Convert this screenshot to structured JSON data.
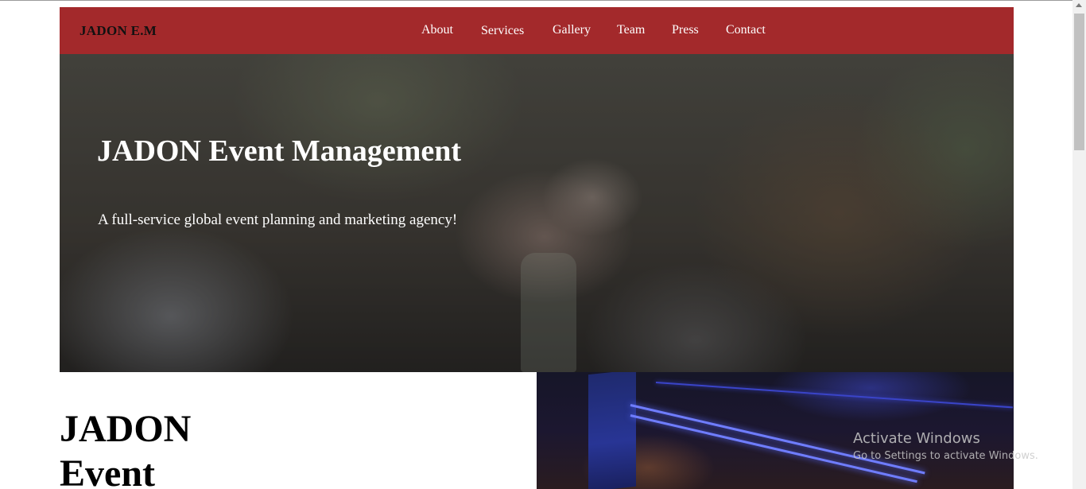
{
  "nav": {
    "brand": "JADON E.M",
    "links": [
      "About",
      "Services",
      "Gallery",
      "Team",
      "Press",
      "Contact"
    ]
  },
  "hero": {
    "title": "JADON Event Management",
    "subtitle": "A full-service global event planning and marketing agency!"
  },
  "about": {
    "heading_line1": "JADON",
    "heading_line2": "Event"
  },
  "watermark": {
    "title": "Activate Windows",
    "subtitle": "Go to Settings to activate Windows."
  },
  "colors": {
    "navbar": "#a3292b",
    "brand_text": "#111111",
    "nav_text": "#ffffff"
  }
}
